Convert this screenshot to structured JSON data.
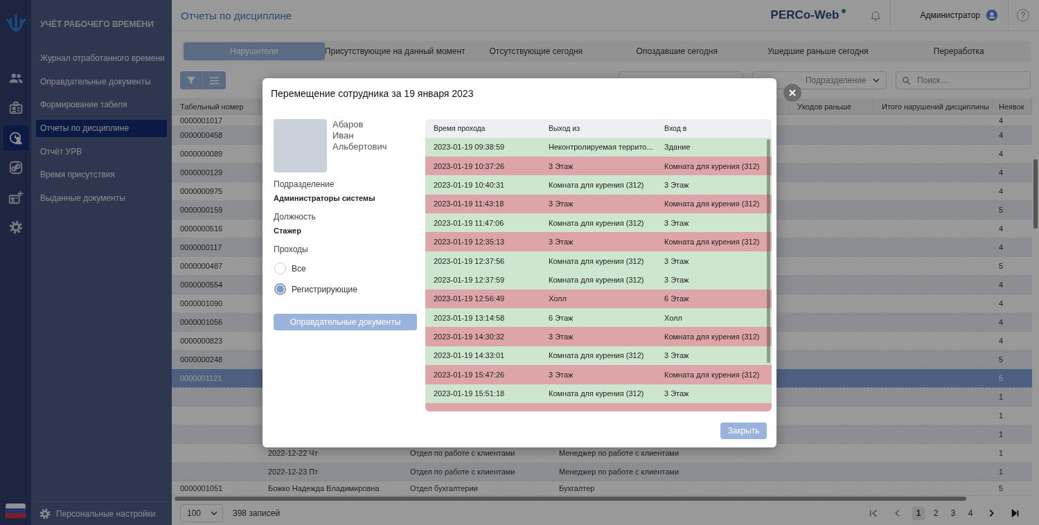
{
  "rail": [
    {
      "kind": "people",
      "selected": false
    },
    {
      "kind": "badge",
      "selected": false
    },
    {
      "kind": "discipline",
      "selected": true
    },
    {
      "kind": "link",
      "selected": false
    },
    {
      "kind": "add-badge",
      "selected": false
    },
    {
      "kind": "gear",
      "selected": false
    }
  ],
  "sidebar": {
    "title": "УЧЁТ РАБОЧЕГО ВРЕМЕНИ",
    "items": [
      {
        "label": "Журнал отработанного времени",
        "selected": false
      },
      {
        "label": "Оправдательные документы",
        "selected": false
      },
      {
        "label": "Формирование табеля",
        "selected": false
      },
      {
        "label": "Отчеты по дисциплине",
        "selected": true
      },
      {
        "label": "Отчёт УРВ",
        "selected": false
      },
      {
        "label": "Время присутствия",
        "selected": false
      },
      {
        "label": "Выданные документы",
        "selected": false
      }
    ],
    "settings": "Персональные настройки"
  },
  "header": {
    "title": "Отчеты по дисциплине",
    "logo": "PERCo-Web",
    "user": "Администратор",
    "help": "?"
  },
  "tabs": [
    {
      "label": "Нарушители",
      "selected": true
    },
    {
      "label": "Присутствующие на данный момент",
      "selected": false
    },
    {
      "label": "Отсутствующие сегодня",
      "selected": false
    },
    {
      "label": "Опоздавшие сегодня",
      "selected": false
    },
    {
      "label": "Ушедшие раньше сегодня",
      "selected": false
    },
    {
      "label": "Переработка",
      "selected": false
    }
  ],
  "filters": {
    "department_placeholder": "Подразделение",
    "search_placeholder": "Поиск..."
  },
  "table": {
    "columns": {
      "number": "Табельный номер",
      "early_leaves": "Уходов раньше",
      "total_violations": "Итого нарушений дисциплины",
      "absences": "Неявок"
    },
    "rows": [
      {
        "number": "0000001017",
        "absences": "4",
        "selected": false
      },
      {
        "number": "0000000458",
        "absences": "4",
        "selected": false
      },
      {
        "number": "0000000089",
        "absences": "4",
        "selected": false
      },
      {
        "number": "0000000129",
        "absences": "4",
        "selected": false
      },
      {
        "number": "0000000975",
        "absences": "4",
        "selected": false
      },
      {
        "number": "0000000159",
        "absences": "5",
        "selected": false
      },
      {
        "number": "0000000516",
        "absences": "4",
        "selected": false
      },
      {
        "number": "0000000117",
        "absences": "4",
        "selected": false
      },
      {
        "number": "0000000487",
        "absences": "5",
        "selected": false
      },
      {
        "number": "0000000554",
        "absences": "4",
        "selected": false
      },
      {
        "number": "0000001090",
        "absences": "4",
        "selected": false
      },
      {
        "number": "0000001056",
        "absences": "4",
        "selected": false
      },
      {
        "number": "0000000823",
        "absences": "4",
        "selected": false
      },
      {
        "number": "0000000248",
        "absences": "5",
        "selected": false
      },
      {
        "number": "0000001121",
        "absences": "5",
        "selected": true
      },
      {
        "absences": "1",
        "selected": false
      },
      {
        "absences": "1",
        "selected": false
      },
      {
        "absences": "1",
        "selected": false
      },
      {
        "column_2": "2022-12-22 Чт",
        "column_3": "Отдел по работе с клиентами",
        "column_4": "Менеджер по работе с клиентами",
        "absences": "1",
        "selected": false
      },
      {
        "column_2": "2022-12-23 Пт",
        "column_3": "Отдел по работе с клиентами",
        "column_4": "Менеджер по работе с клиентами",
        "absences": "1",
        "selected": false
      },
      {
        "number": "0000001051",
        "column_2": "Божко Надежда Владимировна",
        "column_3": "Отдел бухгалтерии",
        "column_4": "Бухгалтер",
        "absences": "5",
        "selected": false
      }
    ]
  },
  "footer": {
    "page_size": "100",
    "records": "398 записей",
    "pages": [
      {
        "label": "1",
        "selected": true
      },
      {
        "label": "2",
        "selected": false
      },
      {
        "label": "3",
        "selected": false
      },
      {
        "label": "4",
        "selected": false
      }
    ]
  },
  "dialog": {
    "title": "Перемещение сотрудника за 19 января 2023",
    "name_lines": [
      "Абаров",
      "Иван",
      "Альбертович"
    ],
    "fields": [
      {
        "label": "Подразделение",
        "value": "Администраторы системы"
      },
      {
        "label": "Должность",
        "value": "Стажер"
      }
    ],
    "passes_label": "Проходы",
    "pass_filter": [
      {
        "label": "Все",
        "selected": false
      },
      {
        "label": "Регистрирующие",
        "selected": true
      }
    ],
    "documents_button": "Оправдательные документы",
    "columns": [
      "Время прохода",
      "Выход из",
      "Вход в"
    ],
    "passes": [
      {
        "time": "2023-01-19 09:38:59",
        "exit": "Неконтролируемая террито...",
        "entry": "Здание",
        "color": "#cde6cd"
      },
      {
        "time": "2023-01-19 10:37:26",
        "exit": "3 Этаж",
        "entry": "Комната для курения (312)",
        "color": "#dea5a8"
      },
      {
        "time": "2023-01-19 10:40:31",
        "exit": "Комната для курения (312)",
        "entry": "3 Этаж",
        "color": "#cde6cd"
      },
      {
        "time": "2023-01-19 11:43:18",
        "exit": "3 Этаж",
        "entry": "Комната для курения (312)",
        "color": "#dea5a8"
      },
      {
        "time": "2023-01-19 11:47:06",
        "exit": "Комната для курения (312)",
        "entry": "3 Этаж",
        "color": "#cde6cd"
      },
      {
        "time": "2023-01-19 12:35:13",
        "exit": "3 Этаж",
        "entry": "Комната для курения (312)",
        "color": "#dea5a8"
      },
      {
        "time": "2023-01-19 12:37:56",
        "exit": "Комната для курения (312)",
        "entry": "3 Этаж",
        "color": "#cde6cd"
      },
      {
        "time": "2023-01-19 12:37:59",
        "exit": "Комната для курения (312)",
        "entry": "3 Этаж",
        "color": "#cde6cd"
      },
      {
        "time": "2023-01-19 12:56:49",
        "exit": "Холл",
        "entry": "6 Этаж",
        "color": "#dea5a8"
      },
      {
        "time": "2023-01-19 13:14:58",
        "exit": "6 Этаж",
        "entry": "Холл",
        "color": "#cde6cd"
      },
      {
        "time": "2023-01-19 14:30:32",
        "exit": "3 Этаж",
        "entry": "Комната для курения (312)",
        "color": "#dea5a8"
      },
      {
        "time": "2023-01-19 14:33:01",
        "exit": "Комната для курения (312)",
        "entry": "3 Этаж",
        "color": "#cde6cd"
      },
      {
        "time": "2023-01-19 15:47:26",
        "exit": "3 Этаж",
        "entry": "Комната для курения (312)",
        "color": "#dea5a8"
      },
      {
        "time": "2023-01-19 15:51:18",
        "exit": "Комната для курения (312)",
        "entry": "3 Этаж",
        "color": "#cde6cd"
      },
      {
        "color": "#dea5a8"
      }
    ],
    "close_button": "Закрыть"
  }
}
